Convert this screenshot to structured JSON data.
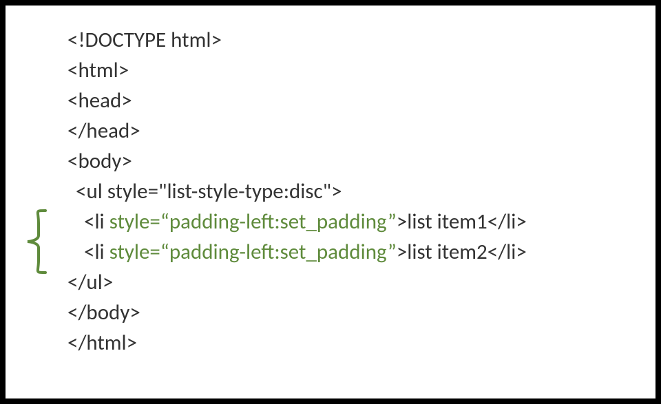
{
  "code": {
    "l1": "<!DOCTYPE html>",
    "l2": "<html>",
    "l3": "<head>",
    "l4": "</head>",
    "l5": "<body>",
    "l6": "<ul style=\"list-style-type:disc\">",
    "l7a": "<li ",
    "l7b": "style=“padding-left:set_padding”",
    "l7c": ">list item1</li>",
    "l8a": "<li ",
    "l8b": "style=“padding-left:set_padding”",
    "l8c": ">list item2</li>",
    "l9": "</ul>",
    "l10": "</body>",
    "l11": "</html>"
  }
}
